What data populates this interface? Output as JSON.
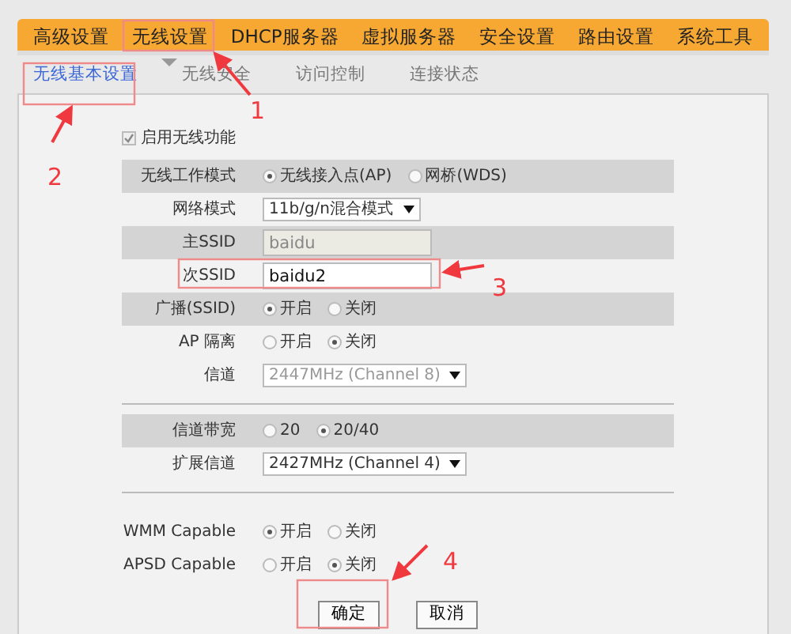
{
  "nav_tabs": [
    {
      "label": "高级设置",
      "selected": false
    },
    {
      "label": "无线设置",
      "selected": true
    },
    {
      "label": "DHCP服务器",
      "selected": false
    },
    {
      "label": "虚拟服务器",
      "selected": false
    },
    {
      "label": "安全设置",
      "selected": false
    },
    {
      "label": "路由设置",
      "selected": false
    },
    {
      "label": "系统工具",
      "selected": false
    }
  ],
  "sub_tabs": [
    {
      "label": "无线基本设置",
      "selected": true
    },
    {
      "label": "无线安全",
      "selected": false
    },
    {
      "label": "访问控制",
      "selected": false
    },
    {
      "label": "连接状态",
      "selected": false
    }
  ],
  "enable_wireless": {
    "label": "启用无线功能",
    "checked": true
  },
  "sections": [
    {
      "fields": [
        {
          "kind": "radio",
          "label": "无线工作模式",
          "shaded": true,
          "options": [
            {
              "label": "无线接入点(AP)",
              "selected": true
            },
            {
              "label": "网桥(WDS)",
              "selected": false
            }
          ]
        },
        {
          "kind": "select",
          "label": "网络模式",
          "shaded": false,
          "value": "11b/g/n混合模式",
          "disabled": false
        },
        {
          "kind": "text",
          "label": "主SSID",
          "shaded": true,
          "value": "baidu",
          "disabled": true
        },
        {
          "kind": "text",
          "label": "次SSID",
          "shaded": false,
          "value": "baidu2",
          "disabled": false
        },
        {
          "kind": "radio",
          "label": "广播(SSID)",
          "shaded": true,
          "options": [
            {
              "label": "开启",
              "selected": true
            },
            {
              "label": "关闭",
              "selected": false
            }
          ]
        },
        {
          "kind": "radio",
          "label": "AP 隔离",
          "shaded": false,
          "options": [
            {
              "label": "开启",
              "selected": false
            },
            {
              "label": "关闭",
              "selected": true
            }
          ]
        },
        {
          "kind": "select",
          "label": "信道",
          "shaded": false,
          "value": "2447MHz (Channel 8)",
          "disabled": true
        }
      ]
    },
    {
      "fields": [
        {
          "kind": "radio",
          "label": "信道带宽",
          "shaded": true,
          "options": [
            {
              "label": "20",
              "selected": false
            },
            {
              "label": "20/40",
              "selected": true
            }
          ]
        },
        {
          "kind": "select",
          "label": "扩展信道",
          "shaded": false,
          "value": "2427MHz (Channel 4)",
          "disabled": false
        }
      ]
    },
    {
      "fields": [
        {
          "kind": "radio",
          "label": "WMM Capable",
          "shaded": false,
          "options": [
            {
              "label": "开启",
              "selected": true
            },
            {
              "label": "关闭",
              "selected": false
            }
          ]
        },
        {
          "kind": "radio",
          "label": "APSD Capable",
          "shaded": false,
          "options": [
            {
              "label": "开启",
              "selected": false
            },
            {
              "label": "关闭",
              "selected": true
            }
          ]
        }
      ]
    }
  ],
  "buttons": [
    "确定",
    "取消"
  ],
  "annotations": [
    {
      "number": "1"
    },
    {
      "number": "2"
    },
    {
      "number": "3"
    },
    {
      "number": "4"
    }
  ]
}
